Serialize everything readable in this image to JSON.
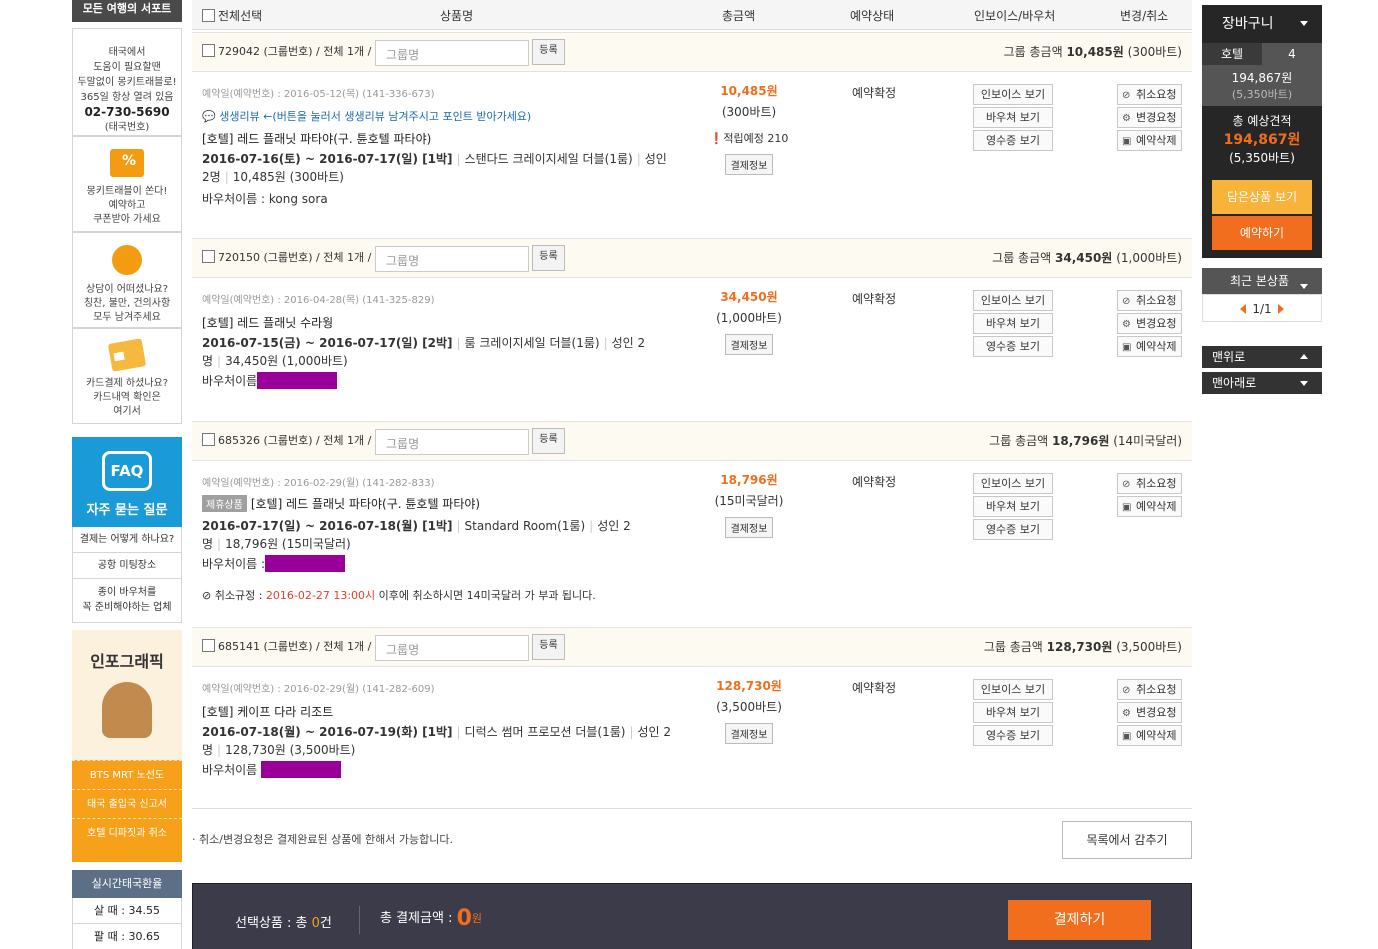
{
  "left": {
    "support_title": "모든 여행의 서포트",
    "support_lines": [
      "태국에서",
      "도움이 필요할땐",
      "두말없이 몽키트래블로!",
      "365일 항상 열려 있음"
    ],
    "support_phone": "02-730-5690",
    "support_region": "(태국번호)",
    "coupon_lines": [
      "몽키트래블이 쏜다!",
      "예약하고",
      "쿠폰받아 가세요"
    ],
    "consult_lines": [
      "상담이 어떠셨나요?",
      "칭찬, 불만, 건의사항",
      "모두 남겨주세요"
    ],
    "card_lines": [
      "카드결제 하셨나요?",
      "카드내역 확인은",
      "여기서"
    ],
    "faq_badge": "FAQ",
    "faq_title": "자주 묻는 질문",
    "faq_links": [
      "결제는 어떻게 하나요?",
      "공항 미팅장소",
      "종이 바우처를",
      "꼭 준비해야하는 업체"
    ],
    "info_title": "인포그래픽",
    "info_links": [
      "BTS MRT 노선도",
      "태국 출입국 신고서",
      "호텔 디파짓과 취소"
    ],
    "fx_title": "실시간태국환율",
    "fx_buy": "살 때 : 34.55",
    "fx_sell": "팔 때 : 30.65"
  },
  "table_header": {
    "select_all": "전체선택",
    "product": "상품명",
    "total": "총금액",
    "status": "예약상태",
    "invoice": "인보이스/바우처",
    "change": "변경/취소"
  },
  "common": {
    "group_placeholder": "그룹명",
    "register": "등록",
    "pay_info": "결제정보",
    "invoice_btn": "인보이스 보기",
    "voucher_btn": "바우쳐 보기",
    "receipt_btn": "영수증 보기",
    "cancel_req": "취소요청",
    "change_req": "변경요청",
    "delete_res": "예약삭제",
    "confirmed": "예약확정",
    "voucher_name_label": "바우처이름 :",
    "voucher_name_label2": "바우처이름"
  },
  "groups": [
    {
      "head": "729042 (그룹번호) / 전체 1개 /",
      "total_label": "그룹 총금액",
      "total_amt": "10,485원",
      "total_sub": "(300바트)",
      "res_date": "예약일(예약번호) : 2016-05-12(목) (141-336-673)",
      "review": "생생리뷰 ←(버튼을 눌러서 생생리뷰 남겨주시고 포인트 받아가세요)",
      "hotel": "[호텔] 레드 플래닛 파타야(구. 튠호텔 파타야)",
      "date_range": "2016-07-16(토) ~ 2016-07-17(일) [1박]",
      "room": "스탠다드 크레이지세일 더블(1룸)",
      "guests": "성인 2명",
      "amount_line": "10,485원 (300바트)",
      "voucher_name": "kong sora",
      "price": "10,485원",
      "price_sub": "(300바트)",
      "point": "적립예정 210"
    },
    {
      "head": "720150 (그룹번호) / 전체 1개 /",
      "total_label": "그룹 총금액",
      "total_amt": "34,450원",
      "total_sub": "(1,000바트)",
      "res_date": "예약일(예약번호) : 2016-04-28(목) (141-325-829)",
      "hotel": "[호텔] 레드 플래닛 수라웡",
      "date_range": "2016-07-15(금) ~ 2016-07-17(일) [2박]",
      "room": "룸 크레이지세일 더블(1룸)",
      "guests": "성인 2명",
      "amount_line": "34,450원 (1,000바트)",
      "price": "34,450원",
      "price_sub": "(1,000바트)"
    },
    {
      "head": "685326 (그룹번호) / 전체 1개 /",
      "total_label": "그룹 총금액",
      "total_amt": "18,796원",
      "total_sub": "(14미국달러)",
      "res_date": "예약일(예약번호) : 2016-02-29(월) (141-282-833)",
      "partner": "제휴상품",
      "hotel": "[호텔] 레드 플래닛 파타야(구. 튠호텔 파타야)",
      "date_range": "2016-07-17(일) ~ 2016-07-18(월) [1박]",
      "room": "Standard Room(1룸)",
      "guests": "성인 2명",
      "amount_line": "18,796원 (15미국달러)",
      "price": "18,796원",
      "price_sub": "(15미국달러)",
      "cancel_label": "취소규정 :",
      "cancel_date": "2016-02-27 13:00시",
      "cancel_text": "이후에 취소하시면 14미국달러 가 부과 됩니다."
    },
    {
      "head": "685141 (그룹번호) / 전체 1개 /",
      "total_label": "그룹 총금액",
      "total_amt": "128,730원",
      "total_sub": "(3,500바트)",
      "res_date": "예약일(예약번호) : 2016-02-29(월) (141-282-609)",
      "hotel": "[호텔] 케이프 다라 리조트",
      "date_range": "2016-07-18(월) ~ 2016-07-19(화) [1박]",
      "room": "디럭스 썸머 프로모션 더블(1룸)",
      "guests": "성인 2명",
      "amount_line": "128,730원 (3,500바트)",
      "price": "128,730원",
      "price_sub": "(3,500바트)"
    }
  ],
  "footer": {
    "note": "취소/변경요청은 결제완료된 상품에 한해서 가능합니다.",
    "hide_list": "목록에서 감추기",
    "selected_label": "선택상품 : 총",
    "selected_count": "0",
    "selected_unit": "건",
    "total_label": "총 결제금액 :",
    "total_value": "0",
    "total_unit": "원",
    "pay_button": "결제하기"
  },
  "cart": {
    "title": "장바구니",
    "category": "호텔",
    "count": "4",
    "amount": "194,867원",
    "amount_sub": "(5,350바트)",
    "estimate_label": "총 예상견적",
    "estimate_value": "194,867원",
    "estimate_sub": "(5,350바트)",
    "view_btn": "담은상품 보기",
    "book_btn": "예약하기",
    "recent_title": "최근 본상품",
    "recent_page": "1/1",
    "to_top": "맨위로",
    "to_bottom": "맨아래로"
  },
  "colors": {
    "accent": "#f06e1d",
    "faq_blue": "#1a9bd7",
    "info_orange": "#f7a11a",
    "redaction": "#990099"
  }
}
